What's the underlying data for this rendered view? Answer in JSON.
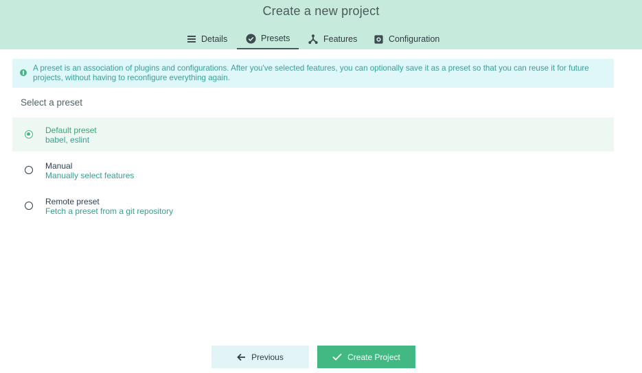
{
  "header": {
    "title": "Create a new project",
    "tabs": [
      {
        "label": "Details",
        "icon": "list-icon",
        "active": false
      },
      {
        "label": "Presets",
        "icon": "check-circle-icon",
        "active": true
      },
      {
        "label": "Features",
        "icon": "branch-icon",
        "active": false
      },
      {
        "label": "Configuration",
        "icon": "gear-icon",
        "active": false
      }
    ]
  },
  "info": {
    "text": "A preset is an association of plugins and configurations. After you've selected features, you can optionally save it as a preset so that you can reuse it for future projects, without having to reconfigure everything again."
  },
  "presets": {
    "label": "Select a preset",
    "options": [
      {
        "name": "Default preset",
        "description": "babel, eslint",
        "selected": true
      },
      {
        "name": "Manual",
        "description": "Manually select features",
        "selected": false
      },
      {
        "name": "Remote preset",
        "description": "Fetch a preset from a git repository",
        "selected": false
      }
    ]
  },
  "footer": {
    "previous_label": "Previous",
    "create_label": "Create Project"
  },
  "colors": {
    "header_bg": "#c6ebdd",
    "accent": "#42b983",
    "info_bg": "#e0f7fa"
  }
}
